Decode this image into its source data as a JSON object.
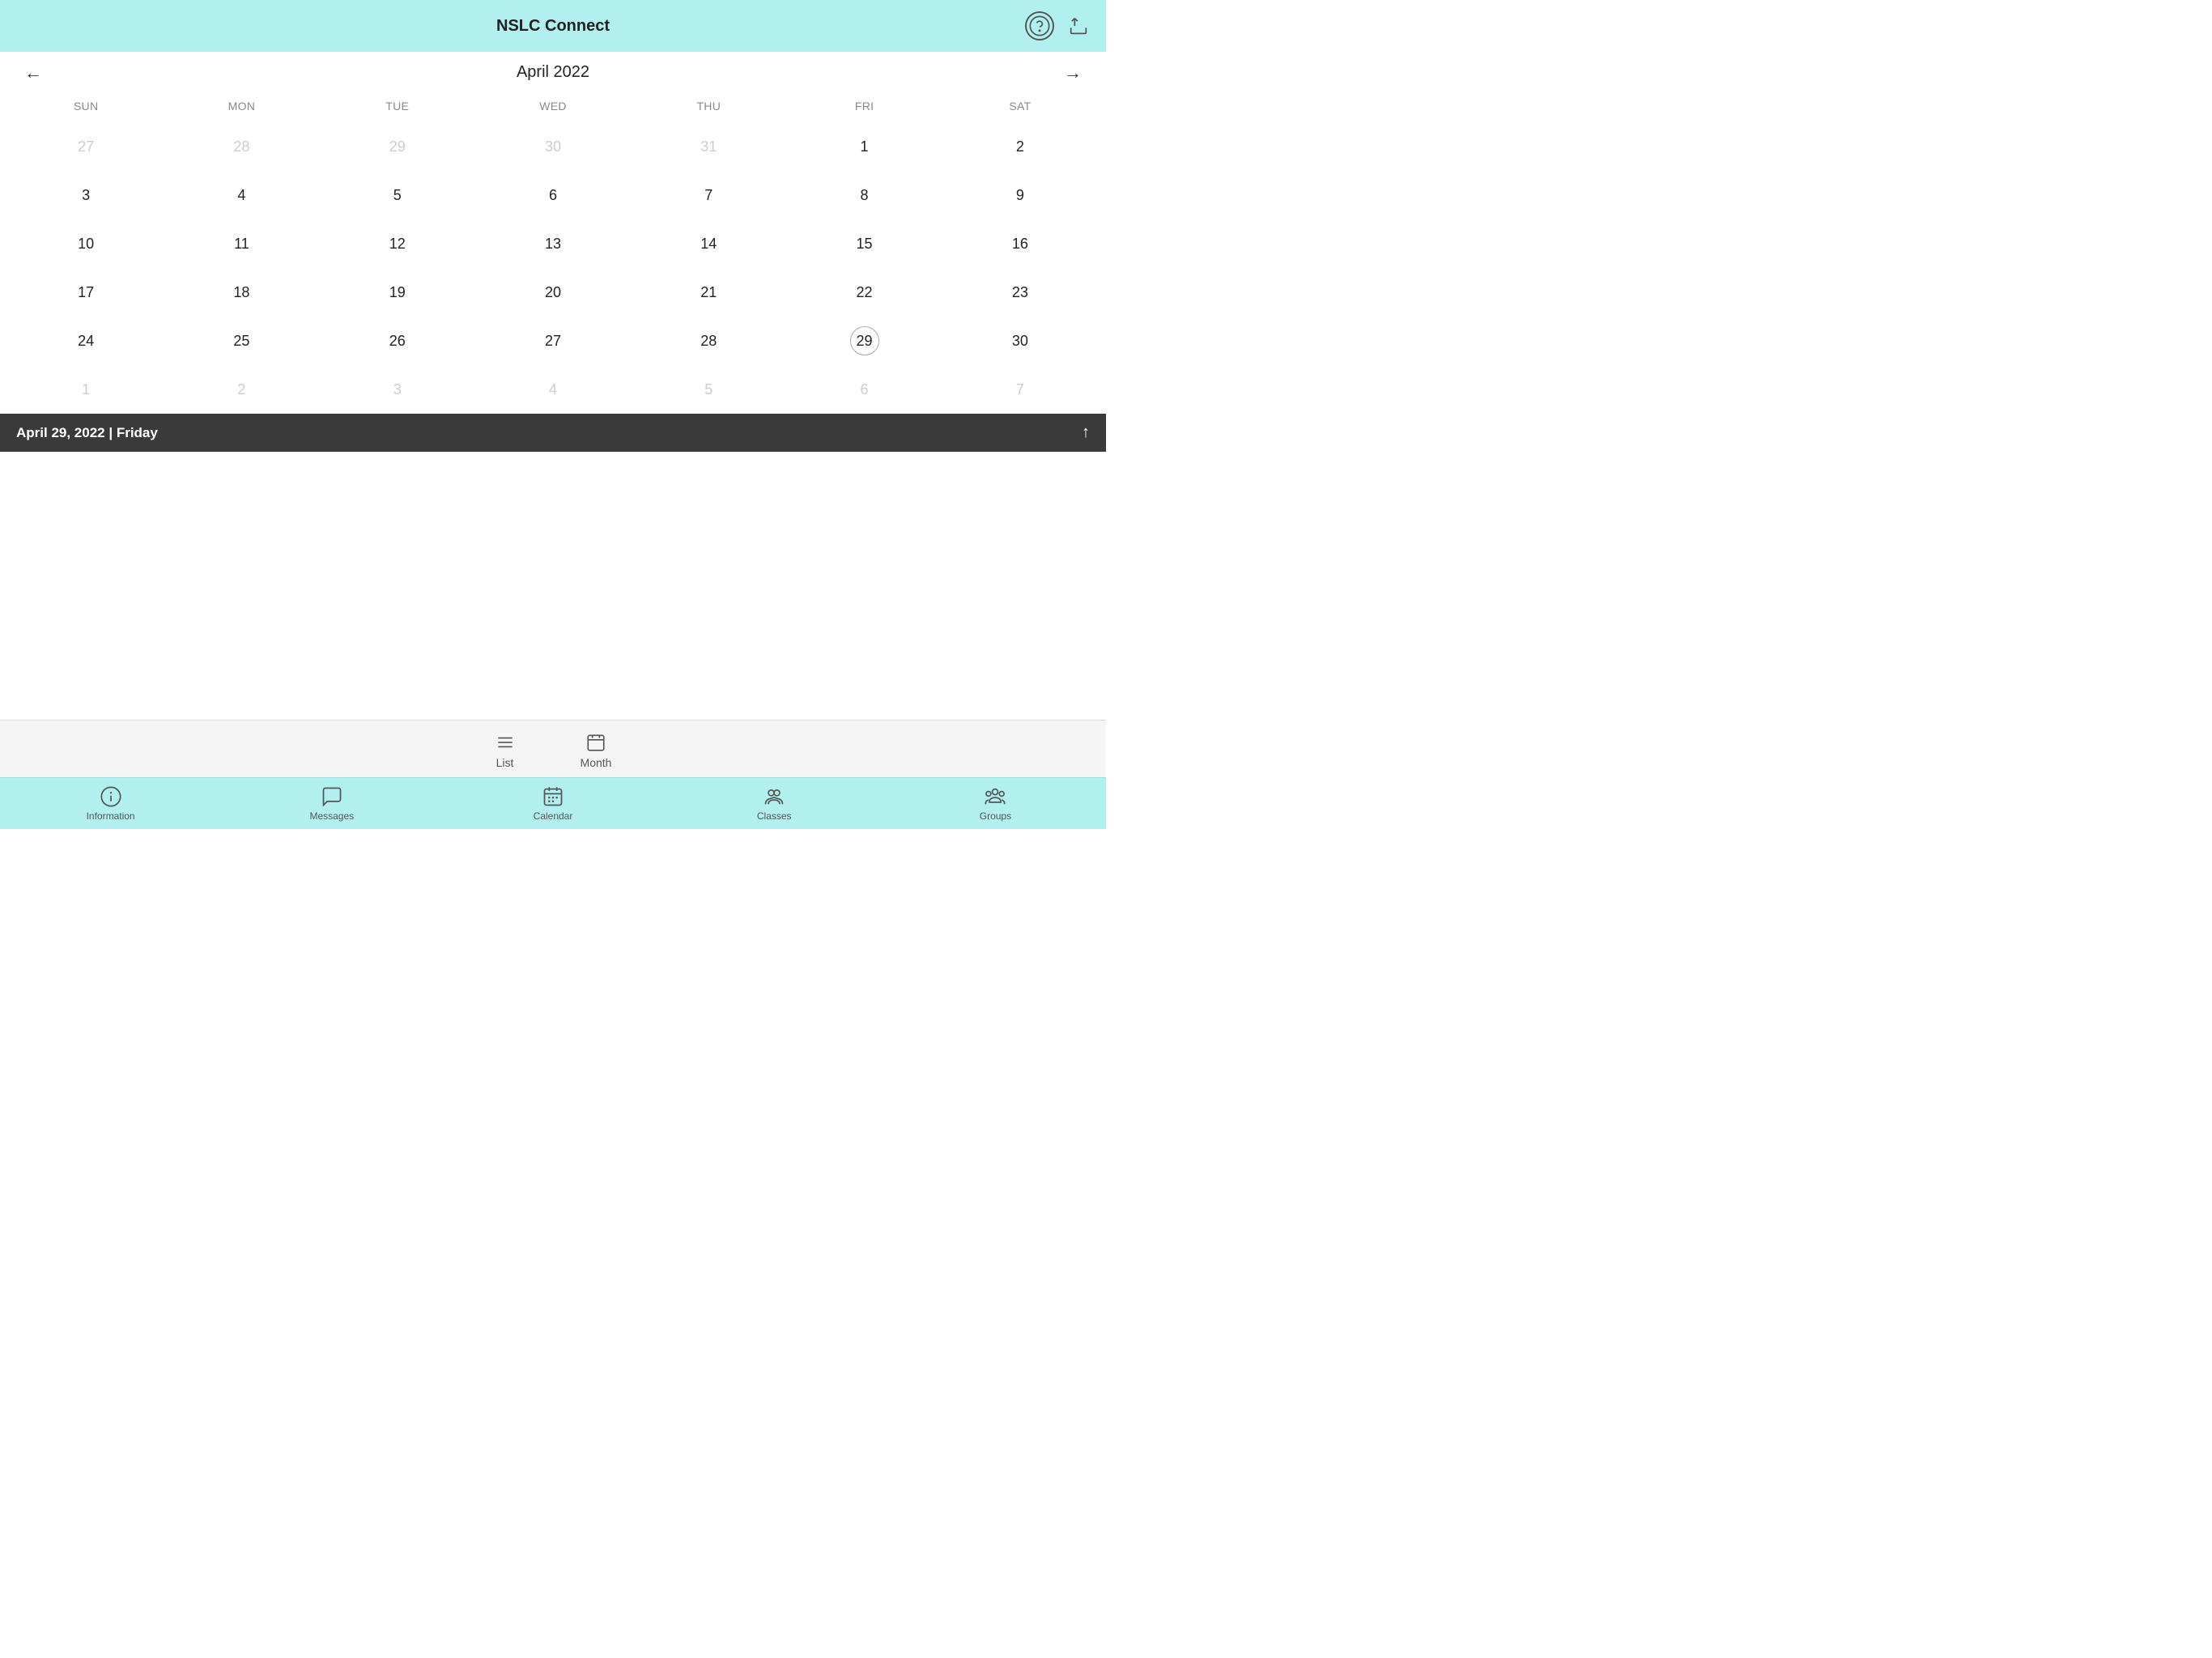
{
  "app": {
    "title": "NSLC Connect"
  },
  "header": {
    "help_icon": "question-circle-icon",
    "share_icon": "share-icon"
  },
  "calendar": {
    "month_title": "April 2022",
    "prev_label": "←",
    "next_label": "→",
    "days_of_week": [
      "SUN",
      "MON",
      "TUE",
      "WED",
      "THU",
      "FRI",
      "SAT"
    ],
    "weeks": [
      [
        {
          "day": "27",
          "dimmed": true
        },
        {
          "day": "28",
          "dimmed": true
        },
        {
          "day": "29",
          "dimmed": true
        },
        {
          "day": "30",
          "dimmed": true
        },
        {
          "day": "31",
          "dimmed": true
        },
        {
          "day": "1",
          "dimmed": false
        },
        {
          "day": "2",
          "dimmed": false
        }
      ],
      [
        {
          "day": "3",
          "dimmed": false
        },
        {
          "day": "4",
          "dimmed": false
        },
        {
          "day": "5",
          "dimmed": false
        },
        {
          "day": "6",
          "dimmed": false
        },
        {
          "day": "7",
          "dimmed": false
        },
        {
          "day": "8",
          "dimmed": false
        },
        {
          "day": "9",
          "dimmed": false
        }
      ],
      [
        {
          "day": "10",
          "dimmed": false
        },
        {
          "day": "11",
          "dimmed": false
        },
        {
          "day": "12",
          "dimmed": false
        },
        {
          "day": "13",
          "dimmed": false
        },
        {
          "day": "14",
          "dimmed": false
        },
        {
          "day": "15",
          "dimmed": false
        },
        {
          "day": "16",
          "dimmed": false
        }
      ],
      [
        {
          "day": "17",
          "dimmed": false
        },
        {
          "day": "18",
          "dimmed": false
        },
        {
          "day": "19",
          "dimmed": false
        },
        {
          "day": "20",
          "dimmed": false
        },
        {
          "day": "21",
          "dimmed": false
        },
        {
          "day": "22",
          "dimmed": false
        },
        {
          "day": "23",
          "dimmed": false
        }
      ],
      [
        {
          "day": "24",
          "dimmed": false
        },
        {
          "day": "25",
          "dimmed": false
        },
        {
          "day": "26",
          "dimmed": false
        },
        {
          "day": "27",
          "dimmed": false
        },
        {
          "day": "28",
          "dimmed": false
        },
        {
          "day": "29",
          "dimmed": false,
          "selected": true
        },
        {
          "day": "30",
          "dimmed": false
        }
      ],
      [
        {
          "day": "1",
          "dimmed": true
        },
        {
          "day": "2",
          "dimmed": true
        },
        {
          "day": "3",
          "dimmed": true
        },
        {
          "day": "4",
          "dimmed": true
        },
        {
          "day": "5",
          "dimmed": true
        },
        {
          "day": "6",
          "dimmed": true
        },
        {
          "day": "7",
          "dimmed": true
        }
      ]
    ],
    "selected_date_label": "April 29, 2022 | Friday"
  },
  "view_toggle": {
    "list_label": "List",
    "month_label": "Month"
  },
  "bottom_nav": {
    "items": [
      {
        "label": "Information",
        "icon": "information-icon"
      },
      {
        "label": "Messages",
        "icon": "messages-icon"
      },
      {
        "label": "Calendar",
        "icon": "calendar-icon"
      },
      {
        "label": "Classes",
        "icon": "classes-icon"
      },
      {
        "label": "Groups",
        "icon": "groups-icon"
      }
    ]
  }
}
